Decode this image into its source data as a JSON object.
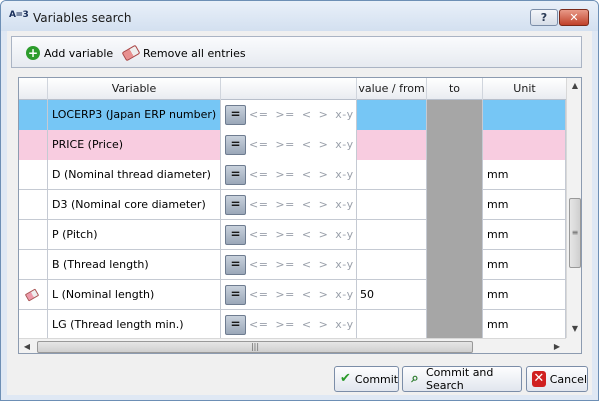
{
  "window": {
    "title": "Variables search",
    "app_icon_text": "A=3"
  },
  "titlebar": {
    "help_label": "?",
    "close_label": "✕"
  },
  "toolbar": {
    "add_label": "Add variable",
    "remove_label": "Remove all entries"
  },
  "grid": {
    "headers": {
      "variable": "Variable",
      "value_from": "value / from",
      "to": "to",
      "unit": "Unit"
    },
    "operator_button": "=",
    "operators": "<= >= < > x-y",
    "rows": [
      {
        "variable": "LOCERP3 (Japan ERP number)",
        "value": "",
        "unit": "",
        "style": "blue"
      },
      {
        "variable": "PRICE (Price)",
        "value": "",
        "unit": "",
        "style": "pink"
      },
      {
        "variable": "D (Nominal thread diameter)",
        "value": "",
        "unit": "mm",
        "style": "normal"
      },
      {
        "variable": "D3 (Nominal core diameter)",
        "value": "",
        "unit": "mm",
        "style": "normal"
      },
      {
        "variable": "P (Pitch)",
        "value": "",
        "unit": "mm",
        "style": "normal"
      },
      {
        "variable": "B (Thread length)",
        "value": "",
        "unit": "mm",
        "style": "normal"
      },
      {
        "variable": "L (Nominal length)",
        "value": "50",
        "unit": "mm",
        "style": "normal"
      },
      {
        "variable": "LG (Thread length min.)",
        "value": "",
        "unit": "mm",
        "style": "normal"
      }
    ]
  },
  "buttons": {
    "commit": "Commit",
    "commit_search": "Commit and Search",
    "cancel": "Cancel"
  },
  "colors": {
    "selected_row": "#76c6f5",
    "pink_row": "#f8cce0",
    "to_column": "#a6a6a6"
  }
}
